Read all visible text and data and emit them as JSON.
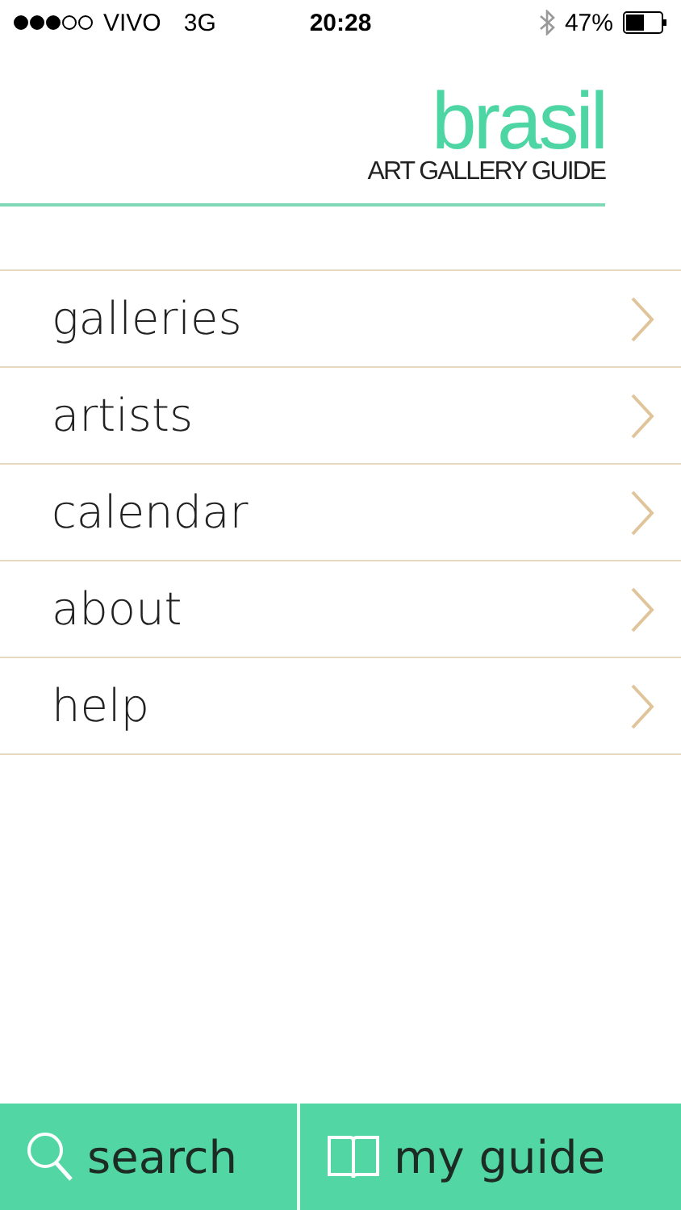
{
  "status_bar": {
    "carrier": "VIVO",
    "network": "3G",
    "time": "20:28",
    "battery": "47%"
  },
  "logo": {
    "title": "brasil",
    "subtitle": "ART GALLERY GUIDE"
  },
  "menu": [
    {
      "label": "galleries"
    },
    {
      "label": "artists"
    },
    {
      "label": "calendar"
    },
    {
      "label": "about"
    },
    {
      "label": "help"
    }
  ],
  "tab_bar": [
    {
      "kind": "search",
      "label": "search"
    },
    {
      "kind": "guide",
      "label": "my guide"
    }
  ]
}
